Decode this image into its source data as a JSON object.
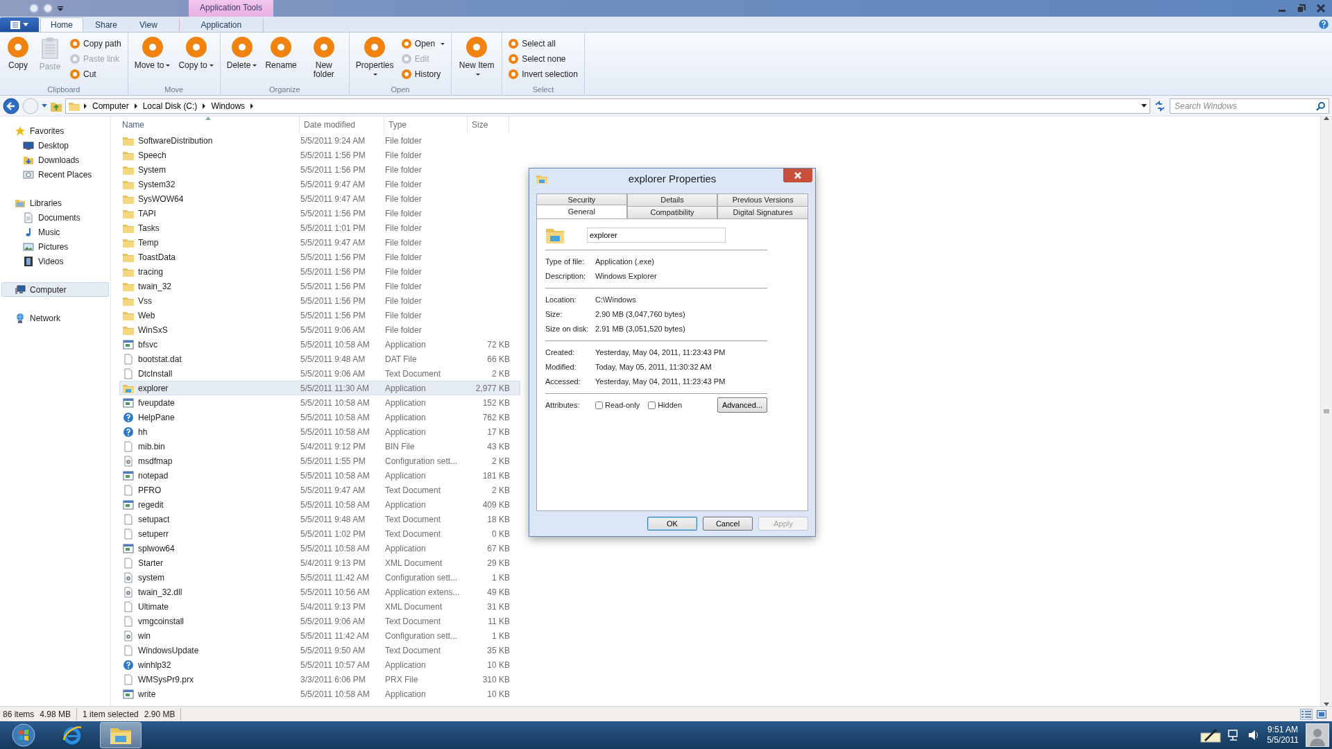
{
  "window": {
    "contextual_tab_group": "Application Tools"
  },
  "ribbon": {
    "tabs": [
      {
        "label": "Home",
        "selected": true,
        "contextual": false
      },
      {
        "label": "Share",
        "selected": false,
        "contextual": false
      },
      {
        "label": "View",
        "selected": false,
        "contextual": false
      },
      {
        "label": "Application",
        "selected": false,
        "contextual": true
      }
    ],
    "groups": [
      {
        "label": "Clipboard",
        "items": [
          {
            "kind": "large",
            "label": "Copy",
            "disabled": false,
            "dropdown": false
          },
          {
            "kind": "large",
            "label": "Paste",
            "disabled": true,
            "dropdown": false
          },
          {
            "kind": "stack",
            "items": [
              {
                "label": "Copy path",
                "disabled": false,
                "dropdown": false
              },
              {
                "label": "Paste link",
                "disabled": true,
                "dropdown": false
              },
              {
                "label": "Cut",
                "disabled": false,
                "dropdown": false
              }
            ]
          }
        ]
      },
      {
        "label": "Move",
        "items": [
          {
            "kind": "large",
            "label": "Move to",
            "disabled": false,
            "dropdown": true
          },
          {
            "kind": "large",
            "label": "Copy to",
            "disabled": false,
            "dropdown": true
          }
        ]
      },
      {
        "label": "Organize",
        "items": [
          {
            "kind": "large",
            "label": "Delete",
            "disabled": false,
            "dropdown": true
          },
          {
            "kind": "large",
            "label": "Rename",
            "disabled": false,
            "dropdown": false
          },
          {
            "kind": "large",
            "label": "New folder",
            "disabled": false,
            "dropdown": false
          }
        ]
      },
      {
        "label": "Open",
        "items": [
          {
            "kind": "large",
            "label": "Properties",
            "disabled": false,
            "dropdown": true
          },
          {
            "kind": "stack",
            "items": [
              {
                "label": "Open",
                "disabled": false,
                "dropdown": true
              },
              {
                "label": "Edit",
                "disabled": true,
                "dropdown": false
              },
              {
                "label": "History",
                "disabled": false,
                "dropdown": false
              }
            ]
          }
        ]
      },
      {
        "items": [
          {
            "kind": "large",
            "label": "New Item",
            "disabled": false,
            "dropdown": true
          }
        ]
      },
      {
        "label": "Select",
        "items": [
          {
            "kind": "stack",
            "items": [
              {
                "label": "Select all",
                "disabled": false,
                "dropdown": false
              },
              {
                "label": "Select none",
                "disabled": false,
                "dropdown": false
              },
              {
                "label": "Invert selection",
                "disabled": false,
                "dropdown": false
              }
            ]
          }
        ]
      }
    ]
  },
  "address_bar": {
    "breadcrumbs": [
      "Computer",
      "Local Disk (C:)",
      "Windows"
    ],
    "search": {
      "placeholder": "Search Windows"
    }
  },
  "navigation": [
    {
      "label": "Favorites",
      "kind": "favorites",
      "selected": false,
      "children": [
        {
          "label": "Desktop",
          "kind": "desktop"
        },
        {
          "label": "Downloads",
          "kind": "downloads"
        },
        {
          "label": "Recent Places",
          "kind": "recent"
        }
      ]
    },
    {
      "label": "Libraries",
      "kind": "libraries",
      "selected": false,
      "children": [
        {
          "label": "Documents",
          "kind": "documents"
        },
        {
          "label": "Music",
          "kind": "music"
        },
        {
          "label": "Pictures",
          "kind": "pictures"
        },
        {
          "label": "Videos",
          "kind": "videos"
        }
      ]
    },
    {
      "label": "Computer",
      "kind": "computer",
      "selected": true
    },
    {
      "label": "Network",
      "kind": "network",
      "selected": false
    }
  ],
  "file_list": {
    "columns": [
      "Name",
      "Date modified",
      "Type",
      "Size"
    ],
    "rows": [
      {
        "name": "SoftwareDistribution",
        "date": "5/5/2011 9:24 AM",
        "type": "File folder",
        "kind": "folder",
        "selected": false
      },
      {
        "name": "Speech",
        "date": "5/5/2011 1:56 PM",
        "type": "File folder",
        "kind": "folder",
        "selected": false
      },
      {
        "name": "System",
        "date": "5/5/2011 1:56 PM",
        "type": "File folder",
        "kind": "folder",
        "selected": false
      },
      {
        "name": "System32",
        "date": "5/5/2011 9:47 AM",
        "type": "File folder",
        "kind": "folder",
        "selected": false
      },
      {
        "name": "SysWOW64",
        "date": "5/5/2011 9:47 AM",
        "type": "File folder",
        "kind": "folder",
        "selected": false
      },
      {
        "name": "TAPI",
        "date": "5/5/2011 1:56 PM",
        "type": "File folder",
        "kind": "folder",
        "selected": false
      },
      {
        "name": "Tasks",
        "date": "5/5/2011 1:01 PM",
        "type": "File folder",
        "kind": "folder",
        "selected": false
      },
      {
        "name": "Temp",
        "date": "5/5/2011 9:47 AM",
        "type": "File folder",
        "kind": "folder",
        "selected": false
      },
      {
        "name": "ToastData",
        "date": "5/5/2011 1:56 PM",
        "type": "File folder",
        "kind": "folder",
        "selected": false
      },
      {
        "name": "tracing",
        "date": "5/5/2011 1:56 PM",
        "type": "File folder",
        "kind": "folder",
        "selected": false
      },
      {
        "name": "twain_32",
        "date": "5/5/2011 1:56 PM",
        "type": "File folder",
        "kind": "folder",
        "selected": false
      },
      {
        "name": "Vss",
        "date": "5/5/2011 1:56 PM",
        "type": "File folder",
        "kind": "folder",
        "selected": false
      },
      {
        "name": "Web",
        "date": "5/5/2011 1:56 PM",
        "type": "File folder",
        "kind": "folder",
        "selected": false
      },
      {
        "name": "WinSxS",
        "date": "5/5/2011 9:06 AM",
        "type": "File folder",
        "kind": "folder",
        "selected": false
      },
      {
        "name": "bfsvc",
        "date": "5/5/2011 10:58 AM",
        "type": "Application",
        "size": "72 KB",
        "kind": "app",
        "selected": false
      },
      {
        "name": "bootstat.dat",
        "date": "5/5/2011 9:48 AM",
        "type": "DAT File",
        "size": "66 KB",
        "kind": "doc",
        "selected": false
      },
      {
        "name": "DtcInstall",
        "date": "5/5/2011 9:06 AM",
        "type": "Text Document",
        "size": "2 KB",
        "kind": "doc",
        "selected": false
      },
      {
        "name": "explorer",
        "date": "5/5/2011 11:30 AM",
        "type": "Application",
        "size": "2,977 KB",
        "kind": "explorer",
        "selected": true
      },
      {
        "name": "fveupdate",
        "date": "5/5/2011 10:58 AM",
        "type": "Application",
        "size": "152 KB",
        "kind": "app",
        "selected": false
      },
      {
        "name": "HelpPane",
        "date": "5/5/2011 10:58 AM",
        "type": "Application",
        "size": "762 KB",
        "kind": "help",
        "selected": false
      },
      {
        "name": "hh",
        "date": "5/5/2011 10:58 AM",
        "type": "Application",
        "size": "17 KB",
        "kind": "help",
        "selected": false
      },
      {
        "name": "mib.bin",
        "date": "5/4/2011 9:12 PM",
        "type": "BIN File",
        "size": "43 KB",
        "kind": "doc",
        "selected": false
      },
      {
        "name": "msdfmap",
        "date": "5/5/2011 1:55 PM",
        "type": "Configuration sett...",
        "size": "2 KB",
        "kind": "config",
        "selected": false
      },
      {
        "name": "notepad",
        "date": "5/5/2011 10:58 AM",
        "type": "Application",
        "size": "181 KB",
        "kind": "app",
        "selected": false
      },
      {
        "name": "PFRO",
        "date": "5/5/2011 9:47 AM",
        "type": "Text Document",
        "size": "2 KB",
        "kind": "doc",
        "selected": false
      },
      {
        "name": "regedit",
        "date": "5/5/2011 10:58 AM",
        "type": "Application",
        "size": "409 KB",
        "kind": "app",
        "selected": false
      },
      {
        "name": "setupact",
        "date": "5/5/2011 9:48 AM",
        "type": "Text Document",
        "size": "18 KB",
        "kind": "doc",
        "selected": false
      },
      {
        "name": "setuperr",
        "date": "5/5/2011 1:02 PM",
        "type": "Text Document",
        "size": "0 KB",
        "kind": "doc",
        "selected": false
      },
      {
        "name": "splwow64",
        "date": "5/5/2011 10:58 AM",
        "type": "Application",
        "size": "67 KB",
        "kind": "app",
        "selected": false
      },
      {
        "name": "Starter",
        "date": "5/4/2011 9:13 PM",
        "type": "XML Document",
        "size": "29 KB",
        "kind": "doc",
        "selected": false
      },
      {
        "name": "system",
        "date": "5/5/2011 11:42 AM",
        "type": "Configuration sett...",
        "size": "1 KB",
        "kind": "config",
        "selected": false
      },
      {
        "name": "twain_32.dll",
        "date": "5/5/2011 10:56 AM",
        "type": "Application extens...",
        "size": "49 KB",
        "kind": "config",
        "selected": false
      },
      {
        "name": "Ultimate",
        "date": "5/4/2011 9:13 PM",
        "type": "XML Document",
        "size": "31 KB",
        "kind": "doc",
        "selected": false
      },
      {
        "name": "vmgcoinstall",
        "date": "5/5/2011 9:06 AM",
        "type": "Text Document",
        "size": "11 KB",
        "kind": "doc",
        "selected": false
      },
      {
        "name": "win",
        "date": "5/5/2011 11:42 AM",
        "type": "Configuration sett...",
        "size": "1 KB",
        "kind": "config",
        "selected": false
      },
      {
        "name": "WindowsUpdate",
        "date": "5/5/2011 9:50 AM",
        "type": "Text Document",
        "size": "35 KB",
        "kind": "doc",
        "selected": false
      },
      {
        "name": "winhlp32",
        "date": "5/5/2011 10:57 AM",
        "type": "Application",
        "size": "10 KB",
        "kind": "help",
        "selected": false
      },
      {
        "name": "WMSysPr9.prx",
        "date": "3/3/2011 6:06 PM",
        "type": "PRX File",
        "size": "310 KB",
        "kind": "doc",
        "selected": false
      },
      {
        "name": "write",
        "date": "5/5/2011 10:58 AM",
        "type": "Application",
        "size": "10 KB",
        "kind": "app",
        "selected": false
      }
    ]
  },
  "status_bar": {
    "item_count": "86 items",
    "total_size": "4.98 MB",
    "selection": "1 item selected",
    "selection_size": "2.90 MB",
    "views": [
      {
        "kind": "details",
        "selected": true
      },
      {
        "kind": "large_icons",
        "selected": false
      }
    ]
  },
  "dialog": {
    "title": "explorer Properties",
    "tab_rows": [
      [
        {
          "label": "Security",
          "selected": false
        },
        {
          "label": "Details",
          "selected": false
        },
        {
          "label": "Previous Versions",
          "selected": false
        }
      ],
      [
        {
          "label": "General",
          "selected": true
        },
        {
          "label": "Compatibility",
          "selected": false
        },
        {
          "label": "Digital Signatures",
          "selected": false
        }
      ]
    ],
    "file_name": "explorer",
    "sections": [
      [
        {
          "label": "Type of file:",
          "value": "Application (.exe)"
        },
        {
          "label": "Description:",
          "value": "Windows Explorer"
        }
      ],
      [
        {
          "label": "Location:",
          "value": "C:\\Windows"
        },
        {
          "label": "Size:",
          "value": "2.90 MB (3,047,760 bytes)"
        },
        {
          "label": "Size on disk:",
          "value": "2.91 MB (3,051,520 bytes)"
        }
      ],
      [
        {
          "label": "Created:",
          "value": "Yesterday, May 04, 2011, 11:23:43 PM"
        },
        {
          "label": "Modified:",
          "value": "Today, May 05, 2011, 11:30:32 AM"
        },
        {
          "label": "Accessed:",
          "value": "Yesterday, May 04, 2011, 11:23:43 PM"
        }
      ]
    ],
    "attributes": {
      "label": "Attributes:",
      "options": [
        {
          "label": "Read-only",
          "checked": false
        },
        {
          "label": "Hidden",
          "checked": false
        }
      ],
      "advanced": "Advanced..."
    },
    "buttons": [
      {
        "label": "OK",
        "default": true,
        "disabled": false
      },
      {
        "label": "Cancel",
        "default": false,
        "disabled": false
      },
      {
        "label": "Apply",
        "default": false,
        "disabled": true
      }
    ]
  },
  "taskbar": {
    "apps": [
      {
        "kind": "browser",
        "active": false
      },
      {
        "kind": "explorer",
        "active": true
      }
    ],
    "time": "9:51 AM",
    "date": "5/5/2011"
  }
}
